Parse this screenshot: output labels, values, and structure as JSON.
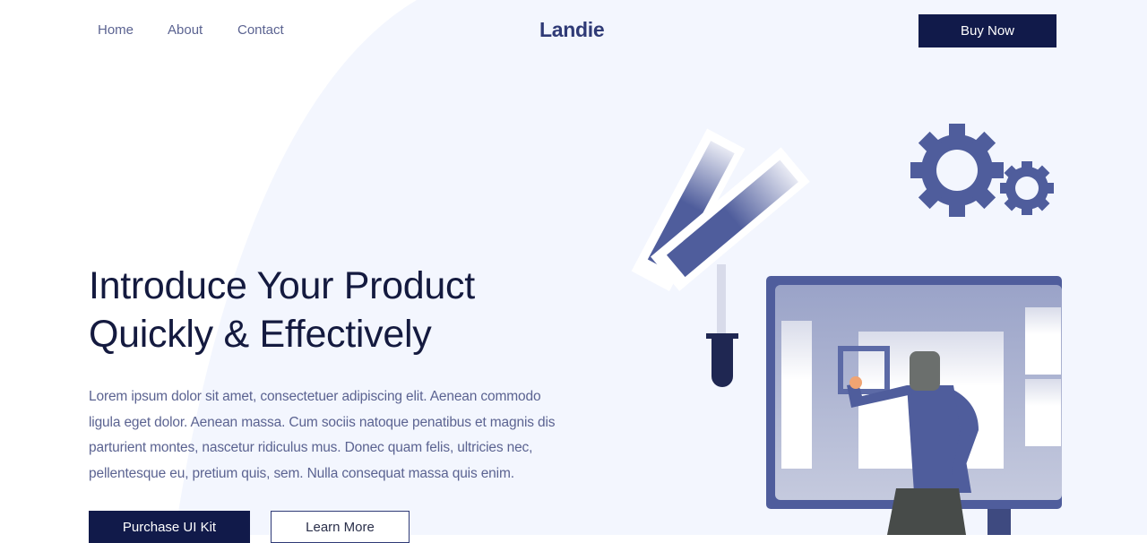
{
  "nav": {
    "links": [
      "Home",
      "About",
      "Contact"
    ],
    "logo": "Landie",
    "buy_label": "Buy Now"
  },
  "hero": {
    "title_lines": [
      "Introduce Your Product",
      "Quickly & Effectively"
    ],
    "paragraph_lines": [
      "Lorem ipsum dolor sit amet, consectetuer adipiscing elit. Aenean commodo",
      "ligula eget dolor. Aenean massa. Cum sociis natoque penatibus et magnis dis",
      "parturient montes, nascetur ridiculus mus. Donec quam felis, ultricies nec,",
      "pellentesque eu, pretium quis, sem. Nulla consequat massa quis enim."
    ],
    "primary_label": "Purchase UI Kit",
    "secondary_label": "Learn More"
  },
  "colors": {
    "brand": "#111a4a",
    "accent": "#4f5d9c",
    "background_blob": "#f3f6fe"
  }
}
